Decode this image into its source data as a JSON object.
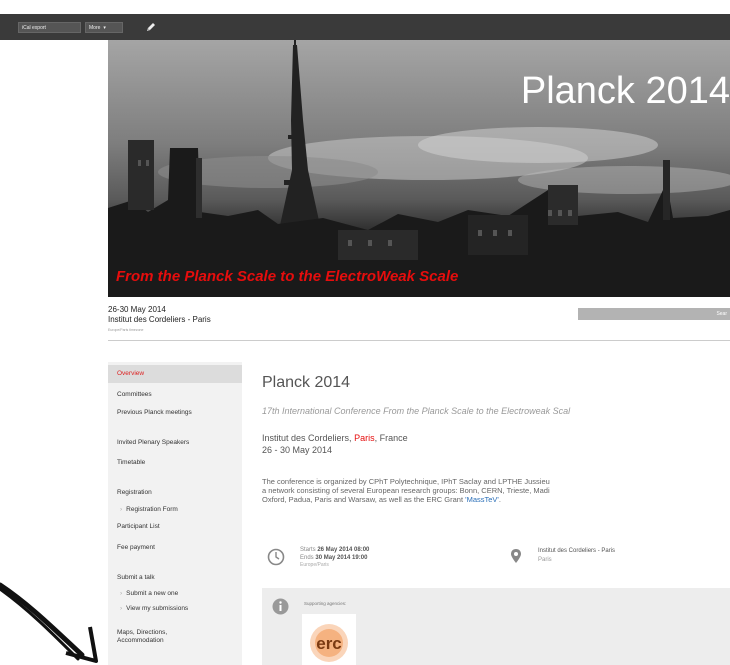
{
  "toolbar": {
    "export_label": "iCal export",
    "more_label": "More",
    "more_caret": "▾"
  },
  "banner": {
    "title": "Planck 2014",
    "subtitle": "From the Planck Scale to the ElectroWeak Scale"
  },
  "event_info": {
    "dates": "26-30 May 2014",
    "place": "Institut des Cordeliers - Paris",
    "timezone": "Europe/Paris timezone",
    "search_label": "Sear"
  },
  "sidebar": {
    "items": [
      {
        "label": "Overview"
      },
      {
        "label": "Committees"
      },
      {
        "label": "Previous Planck meetings"
      },
      {
        "label": "Invited Plenary Speakers"
      },
      {
        "label": "Timetable"
      },
      {
        "label": "Registration"
      },
      {
        "label": "Registration Form"
      },
      {
        "label": "Participant List"
      },
      {
        "label": "Fee payment"
      },
      {
        "label": "Submit a talk"
      },
      {
        "label": "Submit a new one"
      },
      {
        "label": "View my submissions"
      },
      {
        "label": "Maps, Directions,"
      },
      {
        "label": "Accommodation"
      }
    ]
  },
  "main": {
    "title": "Planck 2014",
    "subtitle": "17th International Conference From the Planck Scale to the Electroweak Scal",
    "venue_prefix": "Institut des Cordeliers,",
    "venue_city": "Paris",
    "venue_suffix": ", France",
    "date_range": "26 - 30 May 2014",
    "description_line1": "The conference is organized by CPhT Polytechnique, IPhT Saclay and LPTHE Jussieu",
    "description_line2": "a network consisting of several European research groups: Bonn, CERN, Trieste, Madi",
    "description_line3_prefix": "Oxford, Padua, Paris and Warsaw, as well as the ERC Grant ",
    "description_link": "'MassTeV'",
    "description_line3_suffix": ".",
    "starts_label": "Starts",
    "starts_value": "26 May 2014 08:00",
    "ends_label": "Ends",
    "ends_value": "30 May 2014 19:00",
    "time_zone": "Europe/Paris",
    "location": "Institut des Cordeliers - Paris",
    "location_city": "Paris",
    "supporting_label": "Supporting agencies:",
    "erc_logo_text": "erc"
  },
  "colors": {
    "accent_red": "#e60d0d",
    "link_blue": "#2b6fb8",
    "toolbar_bg": "#3a3a3a",
    "sidebar_bg": "#f2f2f2",
    "erc_orange": "#f0883a"
  }
}
